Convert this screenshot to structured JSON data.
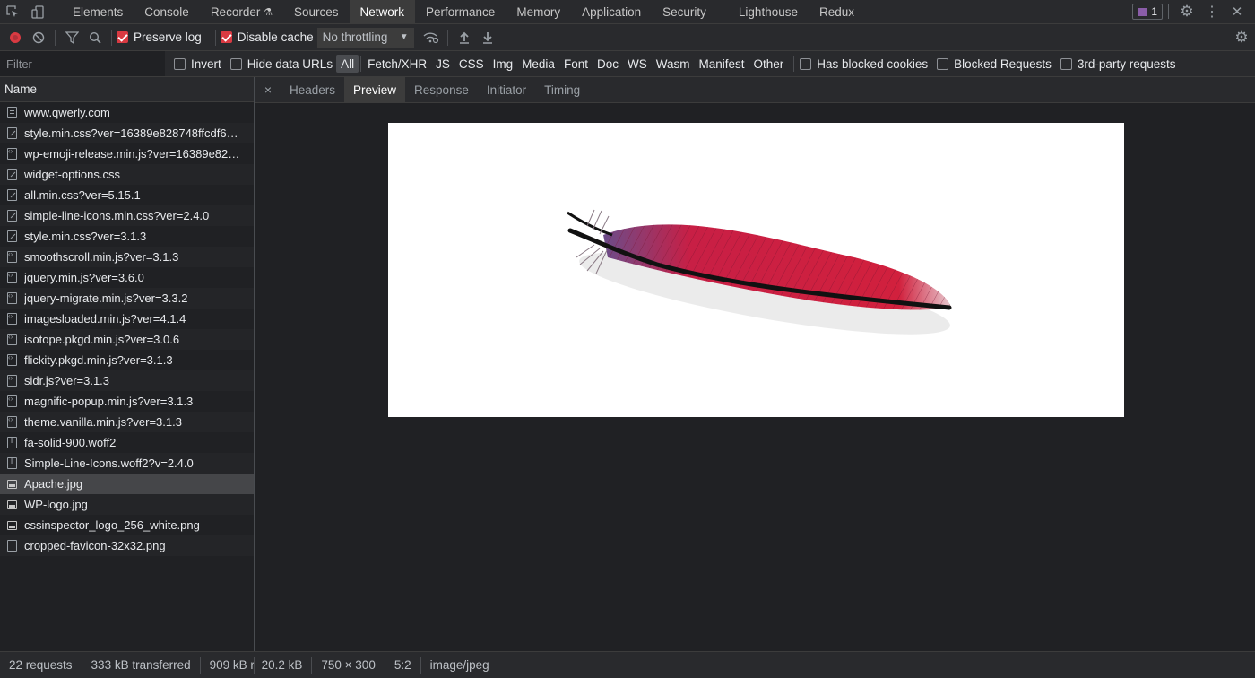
{
  "tabs": [
    "Elements",
    "Console",
    "Recorder",
    "Sources",
    "Network",
    "Performance",
    "Memory",
    "Application",
    "Security",
    "Lighthouse",
    "Redux"
  ],
  "active_tab": "Network",
  "message_count": "1",
  "toolbar": {
    "preserve_log": "Preserve log",
    "disable_cache": "Disable cache",
    "throttling": "No throttling"
  },
  "filter": {
    "placeholder": "Filter",
    "invert": "Invert",
    "hide_data_urls": "Hide data URLs",
    "types": [
      "All",
      "Fetch/XHR",
      "JS",
      "CSS",
      "Img",
      "Media",
      "Font",
      "Doc",
      "WS",
      "Wasm",
      "Manifest",
      "Other"
    ],
    "has_blocked_cookies": "Has blocked cookies",
    "blocked_requests": "Blocked Requests",
    "third_party": "3rd-party requests"
  },
  "requests_header": "Name",
  "requests": [
    {
      "name": "www.qwerly.com",
      "kind": "doc"
    },
    {
      "name": "style.min.css?ver=16389e828748ffcdf6…",
      "kind": "css"
    },
    {
      "name": "wp-emoji-release.min.js?ver=16389e82…",
      "kind": "js"
    },
    {
      "name": "widget-options.css",
      "kind": "css"
    },
    {
      "name": "all.min.css?ver=5.15.1",
      "kind": "css"
    },
    {
      "name": "simple-line-icons.min.css?ver=2.4.0",
      "kind": "css"
    },
    {
      "name": "style.min.css?ver=3.1.3",
      "kind": "css"
    },
    {
      "name": "smoothscroll.min.js?ver=3.1.3",
      "kind": "js"
    },
    {
      "name": "jquery.min.js?ver=3.6.0",
      "kind": "js"
    },
    {
      "name": "jquery-migrate.min.js?ver=3.3.2",
      "kind": "js"
    },
    {
      "name": "imagesloaded.min.js?ver=4.1.4",
      "kind": "js"
    },
    {
      "name": "isotope.pkgd.min.js?ver=3.0.6",
      "kind": "js"
    },
    {
      "name": "flickity.pkgd.min.js?ver=3.1.3",
      "kind": "js"
    },
    {
      "name": "sidr.js?ver=3.1.3",
      "kind": "js"
    },
    {
      "name": "magnific-popup.min.js?ver=3.1.3",
      "kind": "js"
    },
    {
      "name": "theme.vanilla.min.js?ver=3.1.3",
      "kind": "js"
    },
    {
      "name": "fa-solid-900.woff2",
      "kind": "font"
    },
    {
      "name": "Simple-Line-Icons.woff2?v=2.4.0",
      "kind": "font"
    },
    {
      "name": "Apache.jpg",
      "kind": "img",
      "selected": true
    },
    {
      "name": "WP-logo.jpg",
      "kind": "img"
    },
    {
      "name": "cssinspector_logo_256_white.png",
      "kind": "img"
    },
    {
      "name": "cropped-favicon-32x32.png",
      "kind": "other"
    }
  ],
  "detail_tabs": [
    "Headers",
    "Preview",
    "Response",
    "Initiator",
    "Timing"
  ],
  "active_detail_tab": "Preview",
  "status": {
    "requests": "22 requests",
    "transferred": "333 kB transferred",
    "resources": "909 kB r",
    "size": "20.2 kB",
    "dimensions": "750 × 300",
    "ratio": "5:2",
    "mime": "image/jpeg"
  },
  "colors": {
    "accent_checkbox": "#d93a42",
    "feather_red": "#d1203d",
    "feather_purple": "#6b4c8a"
  }
}
